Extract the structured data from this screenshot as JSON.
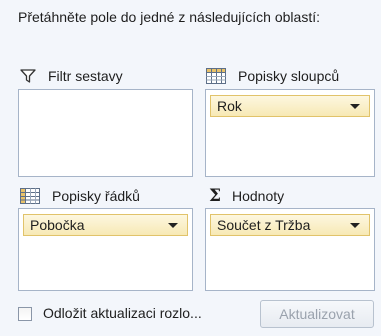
{
  "instruction": "Přetáhněte pole do jedné z následujících oblastí:",
  "zones": {
    "filter": {
      "label": "Filtr sestavy",
      "icon": "filter-funnel-icon",
      "items": []
    },
    "columns": {
      "label": "Popisky sloupců",
      "icon": "column-grid-icon",
      "items": [
        "Rok"
      ]
    },
    "rows": {
      "label": "Popisky řádků",
      "icon": "row-grid-icon",
      "items": [
        "Pobočka"
      ]
    },
    "values": {
      "label": "Hodnoty",
      "icon": "sigma-icon",
      "items": [
        "Součet z Tržba"
      ]
    }
  },
  "defer": {
    "label": "Odložit aktualizaci rozlo...",
    "checked": false
  },
  "update_button": {
    "label": "Aktualizovat",
    "enabled": false
  },
  "colors": {
    "field_fill": "#f7e9b5",
    "field_border": "#e1c36a",
    "zone_border": "#a6b4c8"
  }
}
